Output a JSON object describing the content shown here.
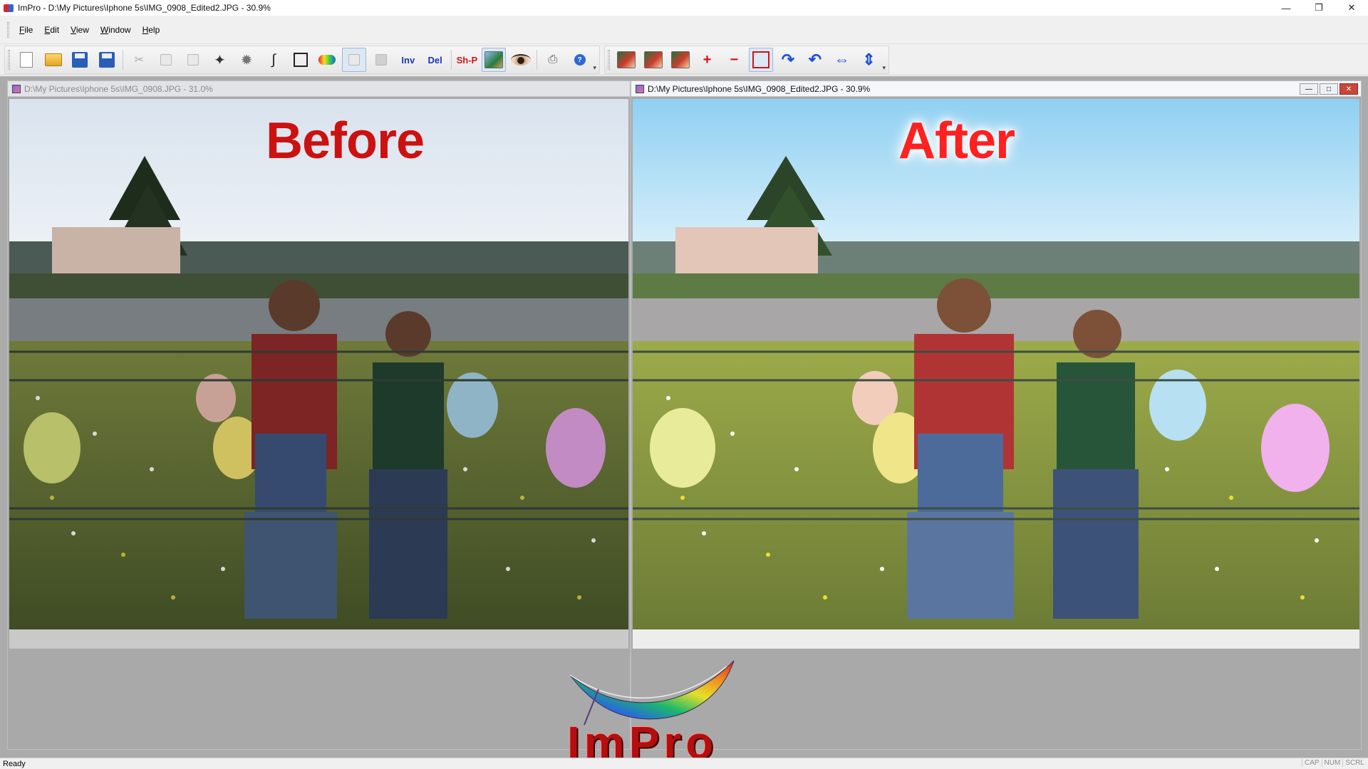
{
  "window": {
    "title": "ImPro - D:\\My Pictures\\Iphone 5s\\IMG_0908_Edited2.JPG - 30.9%",
    "controls": [
      "minimize",
      "restore",
      "close"
    ]
  },
  "menu": {
    "items": [
      {
        "label": "File",
        "accel": "F",
        "rest": "ile"
      },
      {
        "label": "Edit",
        "accel": "E",
        "rest": "dit"
      },
      {
        "label": "View",
        "accel": "V",
        "rest": "iew"
      },
      {
        "label": "Window",
        "accel": "W",
        "rest": "indow"
      },
      {
        "label": "Help",
        "accel": "H",
        "rest": "elp"
      }
    ]
  },
  "toolbar": {
    "inv_label": "Inv",
    "del_label": "Del",
    "shp_label": "Sh-P",
    "plus_label": "+",
    "minus_label": "−",
    "icons": [
      "new-document-icon",
      "open-folder-icon",
      "save-icon",
      "save-all-icon",
      "cut-icon",
      "copy-icon",
      "paste-icon",
      "magic-wand-icon",
      "brush-icon",
      "lasso-icon",
      "rectangle-select-icon",
      "rainbow-brush-icon",
      "layer-icon",
      "layer-merge-icon",
      "landscape-photo-icon",
      "eye-makeup-icon",
      "print-icon",
      "help-icon",
      "face-thumbnail-icon",
      "zoom-in-icon",
      "zoom-out-icon",
      "crop-icon",
      "rotate-right-icon",
      "rotate-left-icon",
      "flip-horizontal-icon",
      "flip-vertical-icon"
    ]
  },
  "documents": {
    "before": {
      "title": "D:\\My Pictures\\Iphone 5s\\IMG_0908.JPG - 31.0%",
      "label": "Before"
    },
    "after": {
      "title": "D:\\My Pictures\\Iphone 5s\\IMG_0908_Edited2.JPG - 30.9%",
      "label": "After"
    }
  },
  "logo": {
    "text": "ImPro"
  },
  "status": {
    "text": "Ready",
    "indicators": [
      "CAP",
      "NUM",
      "SCRL"
    ]
  }
}
